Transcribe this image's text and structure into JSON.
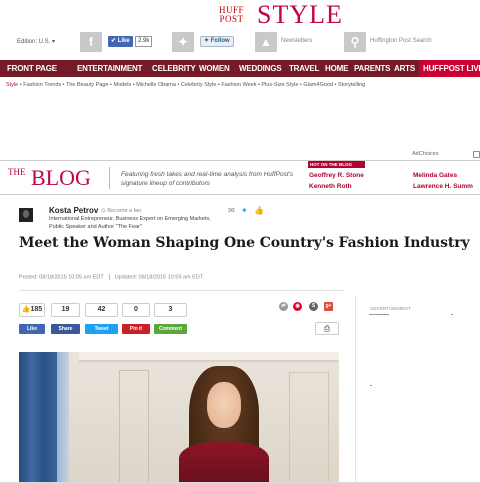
{
  "header": {
    "brand_top": "HUFF",
    "brand_bottom": "POST",
    "brand_section": "STYLE",
    "edition": "Edition: U.S. ▾",
    "fb_like": "Like",
    "fb_count": "2.9k",
    "tw_follow": "Follow",
    "newsletters": "Newsletters",
    "search_placeholder": "Huffington Post Search"
  },
  "nav": {
    "items": [
      "FRONT PAGE",
      "ENTERTAINMENT",
      "CELEBRITY",
      "WOMEN",
      "WEDDINGS",
      "TRAVEL",
      "HOME",
      "PARENTS",
      "ARTS"
    ],
    "live": "HUFFPOST LIVE"
  },
  "subnav": {
    "section": "Style",
    "items": "• Fashion Trends • The Beauty Page • Models • Michelle Obama • Celebrity Style • Fashion Week • Plus-Size Style • Glam4Good • Storytelling"
  },
  "ads": {
    "adchoices": "AdChoices",
    "advertisement": "ADVERTISEMENT"
  },
  "blogbar": {
    "the": "THE",
    "blog": "BLOG",
    "tagline": "Featuring fresh takes and real-time analysis from HuffPost's signature lineup of contributors",
    "hot_label": "HOT ON THE BLOG",
    "links": [
      "Geoffrey R. Stone",
      "Kenneth Roth",
      "Melinda Gates",
      "Lawrence H. Summ"
    ]
  },
  "author": {
    "name": "Kosta Petrov",
    "become_fan": "Become a fan",
    "bio": "International Entrepreneur, Business Expert on Emerging Markets, Public Speaker and Author \"The Fear\""
  },
  "article": {
    "headline": "Meet the Woman Shaping One Country's Fashion Industry",
    "posted": "Posted: 08/18/2015 10:05 am EDT",
    "updated": "Updated: 08/18/2015 10:59 am EDT"
  },
  "share": {
    "counts": [
      "185",
      "19",
      "42",
      "0",
      "3"
    ],
    "buttons": [
      "Like",
      "Share",
      "Tweet",
      "Pin it",
      "Comment"
    ]
  },
  "colors": {
    "brand": "#c4063f",
    "nav_bg": "#751a27",
    "live_bg": "#cc0033",
    "facebook": "#4267b2",
    "twitter": "#1da1f2",
    "pinterest": "#cb2027",
    "comment": "#5aa83b"
  }
}
